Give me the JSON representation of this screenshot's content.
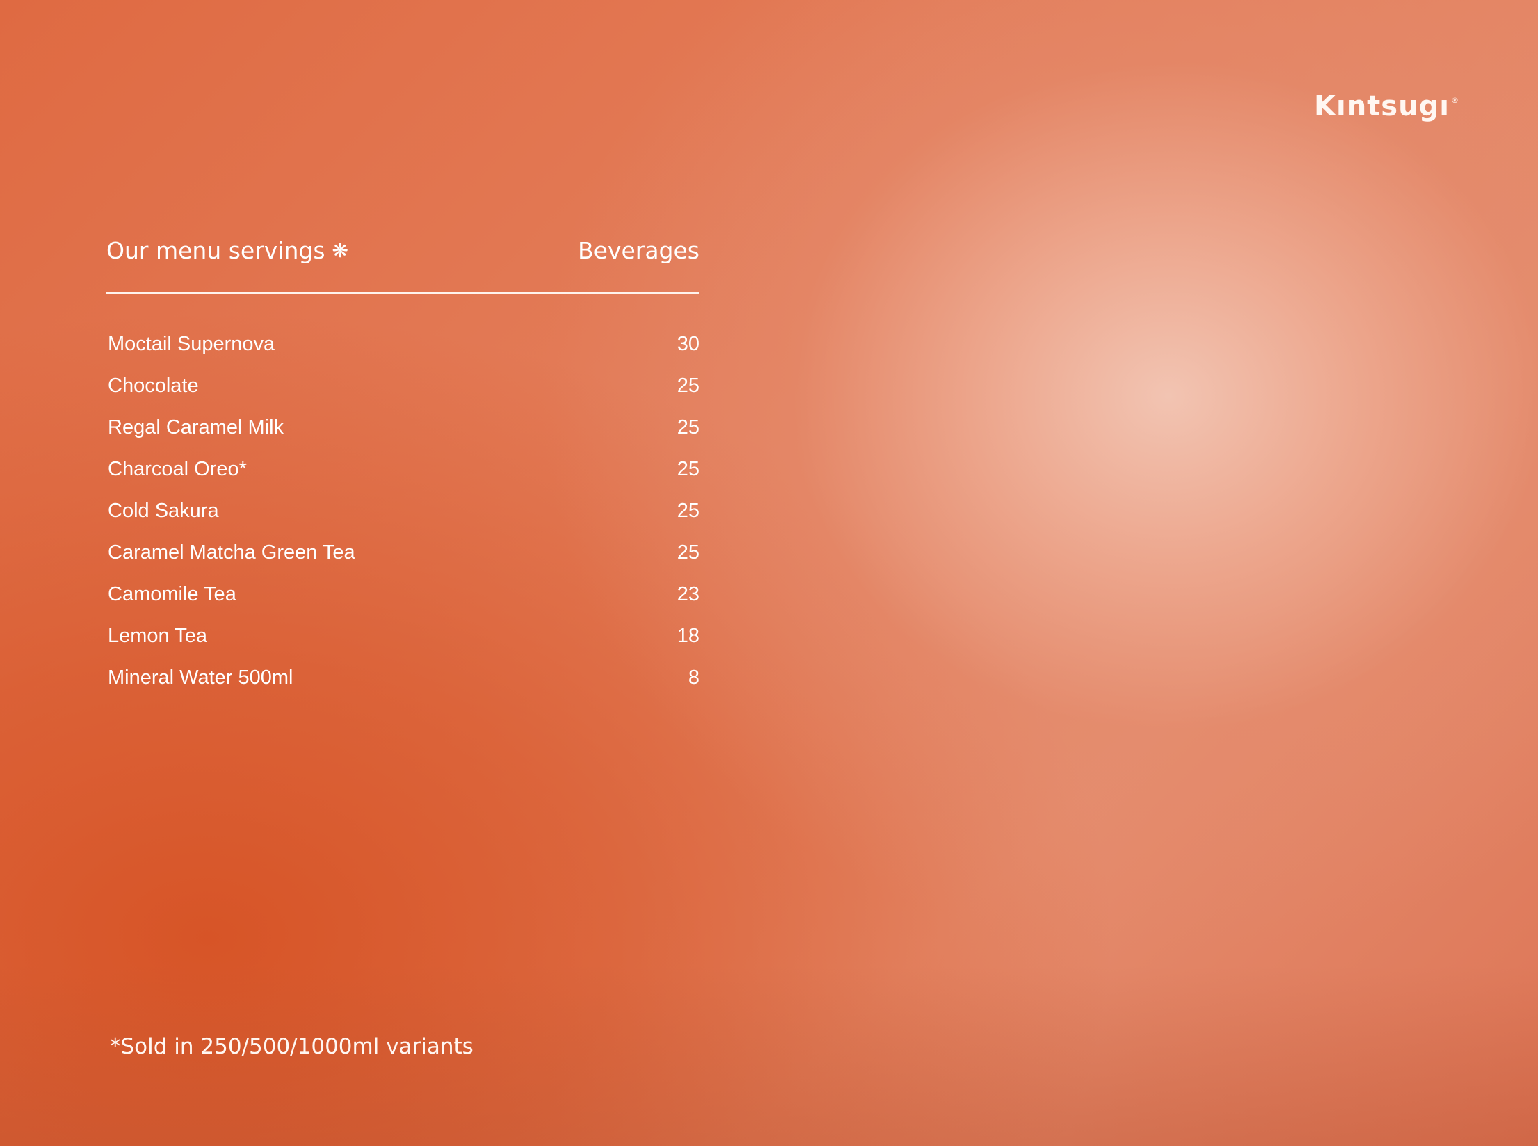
{
  "brand": {
    "name": "Kıntsugı",
    "registered": "®"
  },
  "menu": {
    "title": "Our menu servings",
    "flower_icon": "❋",
    "category": "Beverages",
    "items": [
      {
        "name": "Moctail Supernova",
        "price": "30"
      },
      {
        "name": "Chocolate",
        "price": "25"
      },
      {
        "name": "Regal Caramel Milk",
        "price": "25"
      },
      {
        "name": "Charcoal Oreo*",
        "price": "25"
      },
      {
        "name": "Cold Sakura",
        "price": "25"
      },
      {
        "name": "Caramel Matcha Green Tea",
        "price": "25"
      },
      {
        "name": "Camomile Tea",
        "price": "23"
      },
      {
        "name": "Lemon Tea",
        "price": "18"
      },
      {
        "name": "Mineral Water 500ml",
        "price": "8"
      }
    ]
  },
  "footnote": "*Sold in 250/500/1000ml variants",
  "colors": {
    "background_accent": "#df6a42",
    "highlight": "#f2c4b2",
    "text": "#ffffff"
  }
}
